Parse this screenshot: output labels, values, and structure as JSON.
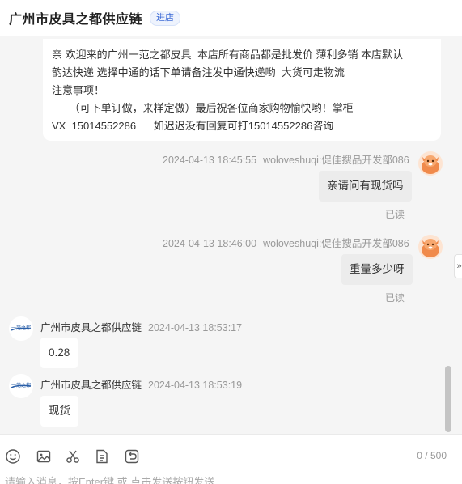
{
  "header": {
    "shop_name": "广州市皮具之都供应链",
    "enter_label": "进店"
  },
  "notice": {
    "lines": [
      "亲 欢迎来的广州一范之都皮具  本店所有商品都是批发价 薄利多销 本店默认",
      "韵达快递 选择中通的话下单请备注发中通快递哟  大货可走物流",
      "注意事项！",
      "      （可下单订做，来样定做）最后祝各位商家购物愉快哟！掌柜",
      "VX  15014552286      如迟迟没有回复可打15014552286咨询"
    ]
  },
  "messages": [
    {
      "time": "2024-04-13 18:45:55",
      "sender": "woloveshuqi:促佳搜品开发部086",
      "text": "亲请问有现货吗",
      "status": "已读"
    },
    {
      "time": "2024-04-13 18:46:00",
      "sender": "woloveshuqi:促佳搜品开发部086",
      "text": "重量多少呀",
      "status": "已读"
    },
    {
      "sender": "广州市皮具之都供应链",
      "time": "2024-04-13 18:53:17",
      "text": "0.28"
    },
    {
      "sender": "广州市皮具之都供应链",
      "time": "2024-04-13 18:53:19",
      "text": "现货"
    }
  ],
  "shop_avatar_text": "一范之都",
  "collapse_glyph": "»",
  "toolbar": {
    "icons": [
      "emoji-icon",
      "image-icon",
      "scissors-icon",
      "document-icon",
      "undo-icon"
    ],
    "counter": "0 / 500"
  },
  "input": {
    "placeholder": "请输入消息，按Enter键 或 点击发送按钮发送"
  },
  "colors": {
    "accent": "#3d6bd6",
    "chat_bg": "#f5f5f5",
    "bubble_right": "#ececec",
    "avatar_orange": "#f08a4b"
  }
}
